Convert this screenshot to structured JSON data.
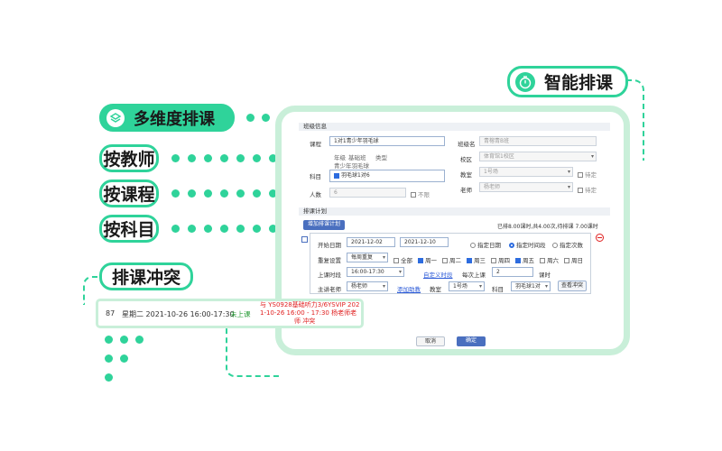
{
  "callouts": {
    "smart": "智能排课",
    "multi": "多维度排课",
    "by_teacher": "按教师",
    "by_course": "按课程",
    "by_subject": "按科目",
    "conflict": "排课冲突"
  },
  "form": {
    "class_info": {
      "section_title": "班级信息",
      "course_label": "课程",
      "course_value": "1对1青少年羽毛球",
      "grade_label": "年级",
      "grade_value": "基础班",
      "type_label": "类型",
      "type_value": "青少年羽毛球",
      "subject_label": "科目",
      "subject_value": "羽毛球1对6",
      "people_label": "人数",
      "people_value": "6",
      "unlimited_label": "不限",
      "class_name_label": "班级名",
      "class_name_value": "青榕青B班",
      "campus_label": "校区",
      "campus_value": "体育馆1校区",
      "classroom_label": "教室",
      "classroom_value": "1号场",
      "teacher_label": "老师",
      "teacher_value": "杨老师",
      "pending_label": "待定"
    },
    "plan": {
      "section_title": "排课计划",
      "add_button": "增加排课计划",
      "summary": "已排8.00课时,共4.00次,待排课 7.00课时",
      "start_date_label": "开始日期",
      "start_date": "2021-12-02",
      "end_date": "2021-12-10",
      "radio_end_date": "指定日期",
      "radio_specified": "指定时间段",
      "radio_count": "指定次数",
      "repeat_label": "重复设置",
      "repeat_value": "每周重复",
      "all_label": "全部",
      "days": [
        {
          "label": "周一",
          "checked": true
        },
        {
          "label": "周二",
          "checked": false
        },
        {
          "label": "周三",
          "checked": true
        },
        {
          "label": "周四",
          "checked": false
        },
        {
          "label": "周五",
          "checked": true
        },
        {
          "label": "周六",
          "checked": false
        },
        {
          "label": "周日",
          "checked": false
        }
      ],
      "time_label": "上课时段",
      "time_value": "16:00-17:30",
      "custom_time_link": "自定义时段",
      "per_class_label": "每次上课",
      "per_class_value": "2",
      "per_class_unit": "课时",
      "teacher_label": "主讲老师",
      "teacher_value": "杨老师",
      "add_assistant_link": "添加助教",
      "classroom_label": "教室",
      "classroom_value": "1号场",
      "subject_label": "科目",
      "subject_value": "羽毛球1对",
      "check_conflict_button": "查看冲突",
      "remove_icon": "minus-circle-icon"
    },
    "footer": {
      "cancel": "取消",
      "confirm": "确定"
    }
  },
  "conflict_row": {
    "index": "87",
    "datetime": "星期二 2021-10-26 16:00-17:30",
    "status": "未上课",
    "conflict_text_1": "与 YS0928基础听力3/6YSVIP 202",
    "conflict_text_2": "1-10-26 16:00 - 17:30 杨老师老",
    "conflict_text_3": "师 冲突"
  },
  "colors": {
    "accent": "#2fd39a",
    "frame": "#c9efd9",
    "conflict_red": "#e02020",
    "status_green": "#2b9d3a",
    "primary_button": "#2d5bd8"
  }
}
